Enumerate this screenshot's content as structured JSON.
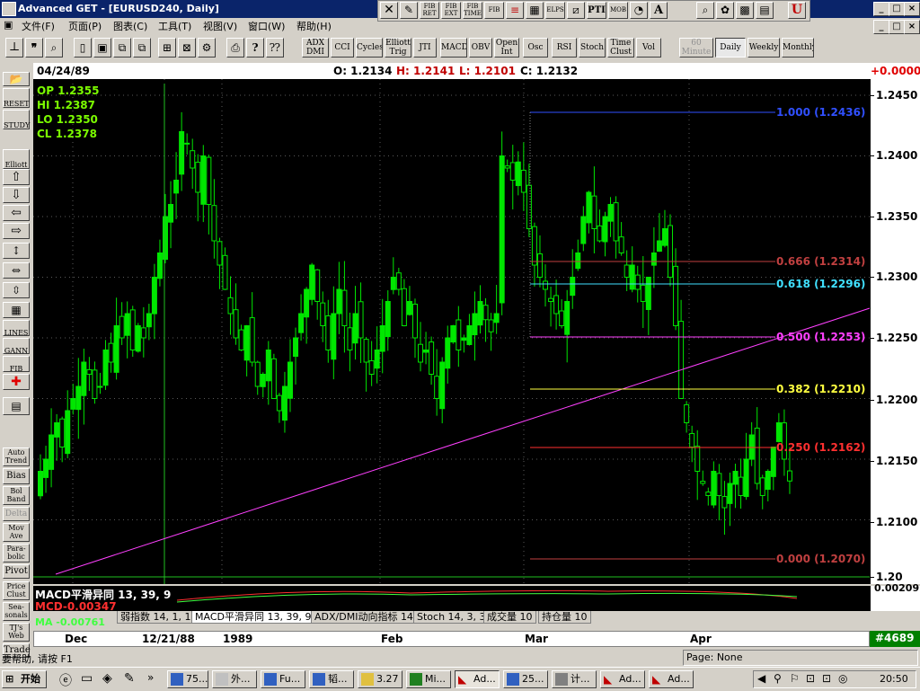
{
  "window": {
    "title": "Advanced GET - [EURUSD240, Daily]"
  },
  "menu": [
    "文件(F)",
    "页面(P)",
    "图表(C)",
    "工具(T)",
    "视图(V)",
    "窗口(W)",
    "帮助(H)"
  ],
  "toolbar_top": [
    "FIB RET",
    "FIB EXT",
    "FIB TIME",
    "FIB",
    "ELPS",
    "PTI",
    "MOB",
    "A"
  ],
  "indicator_buttons": [
    "ADX DMI",
    "CCI",
    "Cycles",
    "Elliott Trig",
    "JTI",
    "MACD",
    "OBV",
    "Open Int",
    "Osc",
    "RSI",
    "Stoch",
    "Time Clust",
    "Vol"
  ],
  "period_buttons": [
    "60 Minute",
    "Daily",
    "Weekly",
    "Monthly"
  ],
  "header": {
    "date": "04/24/89",
    "open": "O: 1.2134",
    "high": "H: 1.2141",
    "low": "L: 1.2101",
    "close": "C: 1.2132",
    "change": "+0.0000"
  },
  "ohlc_box": {
    "op": "OP  1.2355",
    "hi": "HI  1.2387",
    "lo": "LO  1.2350",
    "cl": "CL  1.2378"
  },
  "left_tools": [
    "RESET",
    "STUDY",
    "Elliott",
    "LINES",
    "GANN",
    "FIB",
    "Auto Trend",
    "Bias",
    "Bol Band",
    "Delta",
    "Mov Ave",
    "Para-bolic",
    "Pivot",
    "Price Clust",
    "Sea-sonals",
    "TJ's Web",
    "Trade"
  ],
  "price_axis": [
    "1.2450",
    "1.2400",
    "1.2350",
    "1.2300",
    "1.2250",
    "1.2200",
    "1.2150",
    "1.2100",
    "1.20"
  ],
  "fib_levels": [
    {
      "label": "1.000 (1.2436)",
      "color": "#3050ff"
    },
    {
      "label": "0.666 (1.2314)",
      "color": "#c04040"
    },
    {
      "label": "0.618 (1.2296)",
      "color": "#40e0ff"
    },
    {
      "label": "0.500 (1.2253)",
      "color": "#ff40ff"
    },
    {
      "label": "0.382 (1.2210)",
      "color": "#ffff40"
    },
    {
      "label": "0.250 (1.2162)",
      "color": "#ff3030"
    },
    {
      "label": "0.000 (1.2070)",
      "color": "#c04040"
    }
  ],
  "macd_panel": {
    "title": "MACD平滑异同 13, 39, 9",
    "mcd": "MCD-0.00347",
    "ma": "MA  -0.00761",
    "value": "0.00209"
  },
  "indicator_tabs": [
    "弱指数 14, 1, 1",
    "MACD平滑异同 13, 39, 9",
    "ADX/DMI动向指标 14",
    "Stoch 14, 3, 3",
    "成交量 10",
    "持仓量 10"
  ],
  "time_axis": [
    "Dec",
    "12/21/88",
    "1989",
    "Feb",
    "Mar",
    "Apr"
  ],
  "bar_count": "#4689",
  "status": {
    "help": "要帮助, 请按 F1",
    "page": "Page: None"
  },
  "taskbar": {
    "start": "开始",
    "tasks": [
      "75...",
      "外...",
      "Fu...",
      "韬...",
      "3.27",
      "Mi...",
      "Ad...",
      "25...",
      "计...",
      "Ad...",
      "Ad..."
    ],
    "clock": "20:50"
  },
  "colors": {
    "bars": "#00e600",
    "background": "#000000",
    "trendline": "#ff40ff"
  }
}
